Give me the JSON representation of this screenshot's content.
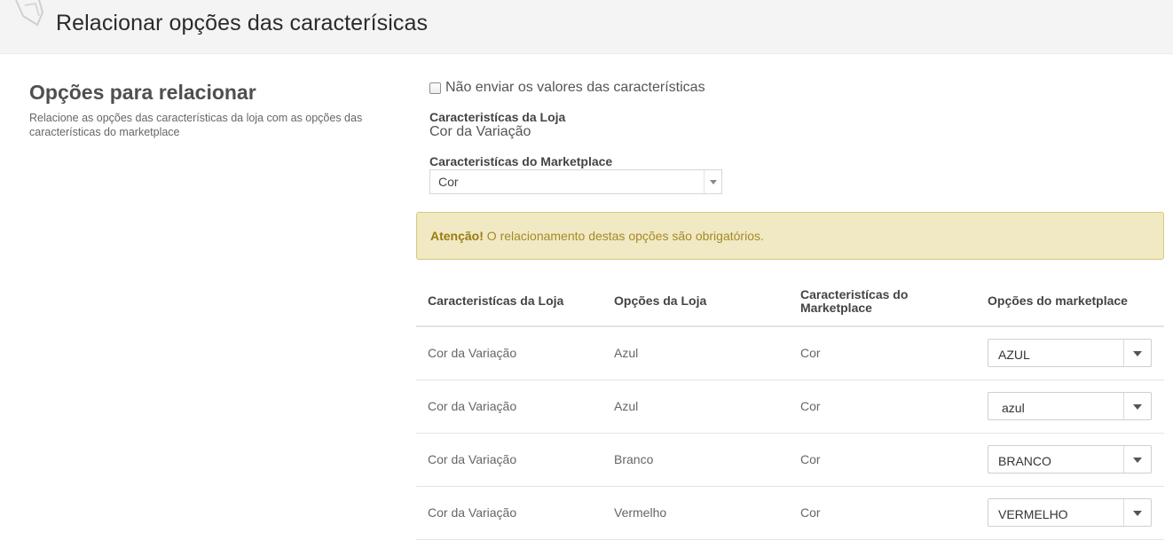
{
  "header": {
    "title": "Relacionar opções das caracterísicas"
  },
  "left": {
    "title": "Opções para relacionar",
    "description": "Relacione as opções das características da loja com as opções das características do marketplace"
  },
  "form": {
    "no_send_label": "Não enviar os valores das características",
    "no_send_checked": false,
    "store_char_label": "Caracteristícas da Loja",
    "store_char_value": "Cor da Variação",
    "marketplace_char_label": "Caracteristícas do Marketplace",
    "marketplace_char_selected": "Cor"
  },
  "alert": {
    "strong": "Atenção!",
    "text": " O relacionamento destas opções são obrigatórios."
  },
  "table": {
    "headers": [
      "Caracteristícas da Loja",
      "Opções da Loja",
      "Caracteristícas do Marketplace",
      "Opções do marketplace"
    ],
    "rows": [
      {
        "store_char": "Cor da Variação",
        "store_option": "Azul",
        "marketplace_char": "Cor",
        "marketplace_option": "AZUL"
      },
      {
        "store_char": "Cor da Variação",
        "store_option": "Azul",
        "marketplace_char": "Cor",
        "marketplace_option": "azul"
      },
      {
        "store_char": "Cor da Variação",
        "store_option": "Branco",
        "marketplace_char": "Cor",
        "marketplace_option": "BRANCO"
      },
      {
        "store_char": "Cor da Variação",
        "store_option": "Vermelho",
        "marketplace_char": "Cor",
        "marketplace_option": "VERMELHO"
      }
    ]
  }
}
